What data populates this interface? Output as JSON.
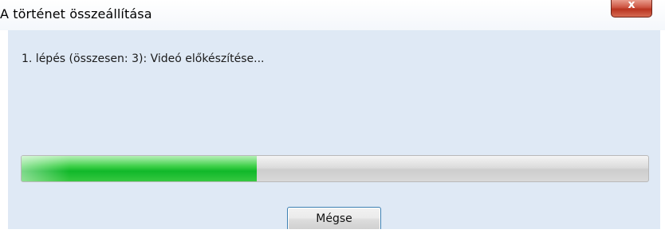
{
  "window": {
    "title": "A történet összeállítása",
    "close_glyph": "x"
  },
  "dialog": {
    "step_text": "1. lépés (összesen: 3): Videó előkészítése...",
    "progress_fraction": 0.375,
    "cancel_label": "Mégse"
  },
  "colors": {
    "content_background": "#dfe9f5",
    "progress_fill": "#11b82a",
    "close_button": "#c8412d"
  },
  "icons": {
    "close": "close-icon"
  }
}
